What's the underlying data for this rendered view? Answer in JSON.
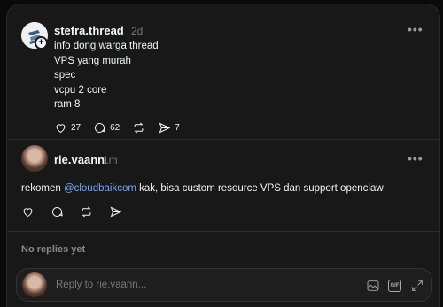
{
  "post": {
    "username": "stefra.thread",
    "time": "2d",
    "more": "•••",
    "lines": [
      "info dong warga thread",
      "VPS yang murah",
      "spec",
      "vcpu 2 core",
      "ram 8"
    ],
    "likes": "27",
    "comments": "62",
    "shares": "7"
  },
  "reply": {
    "username": "rie.vaann",
    "time": "1m",
    "more": "•••",
    "text_before": "rekomen ",
    "mention": "@cloudbaikcom",
    "text_after": " kak, bisa custom resource VPS dan support openclaw"
  },
  "replies_status": "No replies yet",
  "composer": {
    "placeholder": "Reply to rie.vaann...",
    "gif_label": "GIF"
  },
  "colors": {
    "background": "#0a0a0a",
    "card": "#181818",
    "mention": "#6ea8ff"
  }
}
